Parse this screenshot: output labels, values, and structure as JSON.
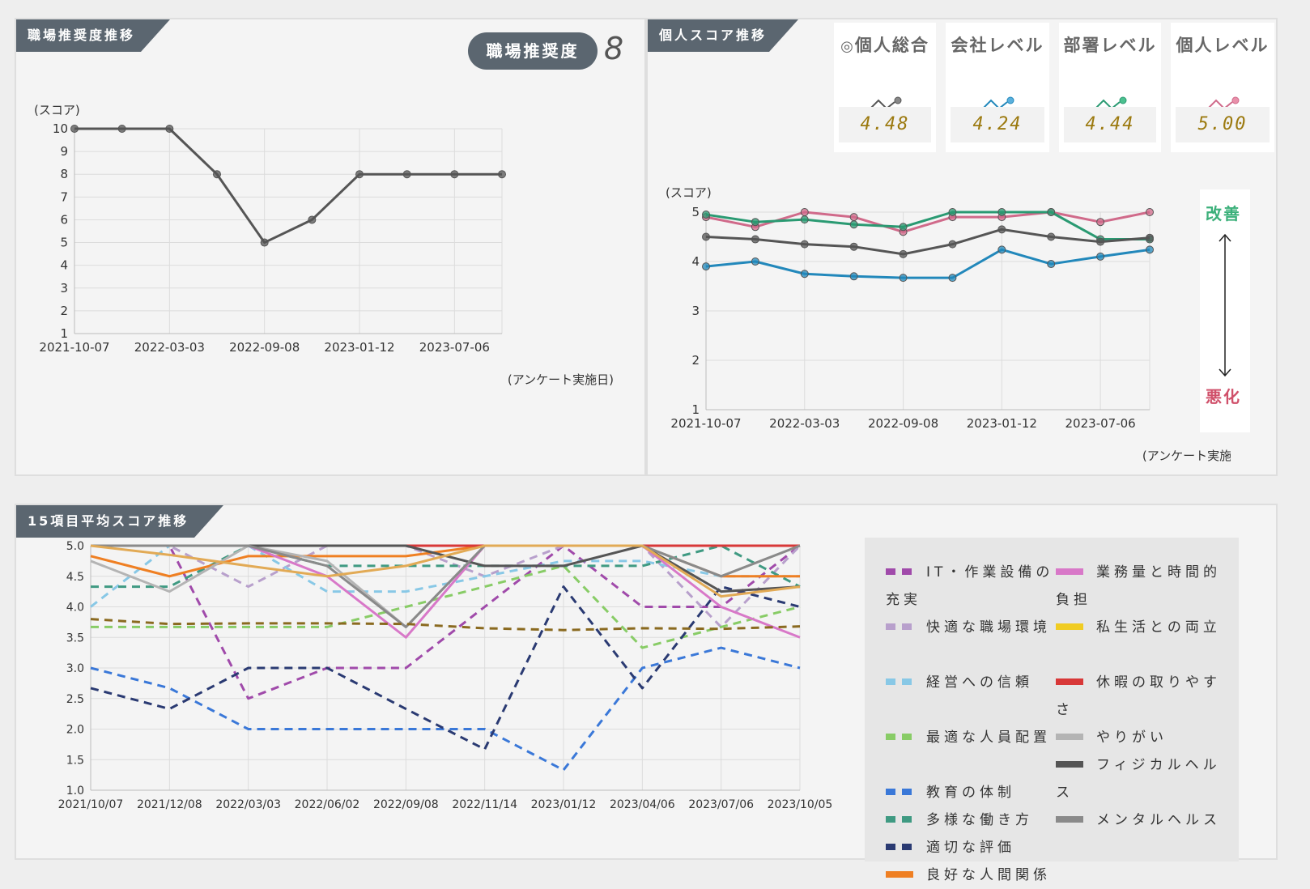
{
  "panels": {
    "workplace": {
      "title": "職場推奨度推移",
      "badge_label": "職場推奨度",
      "badge_value": "8"
    },
    "personal": {
      "title": "個人スコア推移"
    },
    "items15": {
      "title": "15項目平均スコア推移"
    }
  },
  "score_cards": [
    {
      "label": "個人総合",
      "value": "4.48",
      "color": "#555555",
      "icon": "target-icon"
    },
    {
      "label": "会社レベル",
      "value": "4.24",
      "color": "#2288bb"
    },
    {
      "label": "部署レベル",
      "value": "4.44",
      "color": "#2a9a72"
    },
    {
      "label": "個人レベル",
      "value": "5.00",
      "color": "#d06a8a"
    }
  ],
  "direction": {
    "up_label": "改善",
    "down_label": "悪化",
    "up_color": "#3bb07a",
    "down_color": "#d0506a"
  },
  "chart_data": [
    {
      "type": "line",
      "ylabel": "(スコア)",
      "xlabel": "(アンケート実施日)",
      "x": [
        "2021-10-07",
        "2021-12-08",
        "2022-03-03",
        "2022-06-02",
        "2022-09-08",
        "2022-11-14",
        "2023-01-12",
        "2023-04-06",
        "2023-07-06",
        "2023-10-05"
      ],
      "x_tick_labels": [
        "2021-10-07",
        "2022-03-03",
        "2022-09-08",
        "2023-01-12",
        "2023-07-06"
      ],
      "ylim": [
        1,
        10
      ],
      "y_ticks": [
        1,
        2,
        3,
        4,
        5,
        6,
        7,
        8,
        9,
        10
      ],
      "grid": true,
      "series": [
        {
          "values": [
            10,
            10,
            10,
            8,
            5,
            6,
            8,
            8,
            8,
            8
          ],
          "color": "#555555"
        }
      ]
    },
    {
      "type": "line",
      "ylabel": "(スコア)",
      "xlabel": "(アンケート実施日)",
      "x": [
        "2021-10-07",
        "2021-12-08",
        "2022-03-03",
        "2022-06-02",
        "2022-09-08",
        "2022-11-14",
        "2023-01-12",
        "2023-04-06",
        "2023-07-06",
        "2023-10-05"
      ],
      "x_tick_labels": [
        "2021-10-07",
        "2022-03-03",
        "2022-09-08",
        "2023-01-12",
        "2023-07-06"
      ],
      "ylim": [
        1,
        5
      ],
      "y_ticks": [
        1,
        2,
        3,
        4,
        5
      ],
      "grid": true,
      "series": [
        {
          "values": [
            4.9,
            4.7,
            5.0,
            4.9,
            4.6,
            4.9,
            4.9,
            5.0,
            4.8,
            5.0
          ],
          "color": "#d06a8a"
        },
        {
          "values": [
            4.95,
            4.8,
            4.85,
            4.75,
            4.7,
            5.0,
            5.0,
            5.0,
            4.45,
            4.45
          ],
          "color": "#2a9a72"
        },
        {
          "values": [
            4.5,
            4.45,
            4.35,
            4.3,
            4.15,
            4.35,
            4.65,
            4.5,
            4.4,
            4.48
          ],
          "color": "#555555"
        },
        {
          "values": [
            3.9,
            4.0,
            3.75,
            3.7,
            3.67,
            3.67,
            4.24,
            3.95,
            4.1,
            4.24
          ],
          "color": "#2288bb"
        }
      ]
    },
    {
      "type": "line",
      "x": [
        "2021/10/07",
        "2021/12/08",
        "2022/03/03",
        "2022/06/02",
        "2022/09/08",
        "2022/11/14",
        "2023/01/12",
        "2023/04/06",
        "2023/07/06",
        "2023/10/05"
      ],
      "ylim": [
        1.0,
        5.0
      ],
      "y_ticks": [
        "1.0",
        "1.5",
        "2.0",
        "2.5",
        "3.0",
        "3.5",
        "4.0",
        "4.5",
        "5.0"
      ],
      "grid": true,
      "legend_position": "right",
      "series": [
        {
          "name": "IT・作業設備の充実",
          "color": "#a04aaa",
          "dashed": true,
          "values": [
            5.0,
            5.0,
            2.5,
            3.0,
            3.0,
            4.0,
            5.0,
            4.0,
            4.0,
            5.0
          ]
        },
        {
          "name": "快適な職場環境",
          "color": "#b8a0cc",
          "dashed": true,
          "values": [
            5.0,
            5.0,
            4.33,
            5.0,
            5.0,
            4.5,
            5.0,
            5.0,
            3.67,
            5.0
          ]
        },
        {
          "name": "経営への信頼",
          "color": "#88c8e6",
          "dashed": true,
          "values": [
            4.0,
            5.0,
            5.0,
            4.25,
            4.25,
            4.5,
            4.75,
            4.75,
            4.5,
            4.5
          ]
        },
        {
          "name": "最適な人員配置",
          "color": "#88cc66",
          "dashed": true,
          "values": [
            3.67,
            3.67,
            3.67,
            3.67,
            4.0,
            4.33,
            4.67,
            3.33,
            3.67,
            4.0
          ]
        },
        {
          "name": "教育の体制",
          "color": "#3a78d8",
          "dashed": true,
          "values": [
            3.0,
            2.67,
            2.0,
            2.0,
            2.0,
            2.0,
            1.33,
            3.0,
            3.33,
            3.0
          ]
        },
        {
          "name": "多様な働き方",
          "color": "#3f9a82",
          "dashed": true,
          "values": [
            4.33,
            4.33,
            5.0,
            4.67,
            4.67,
            4.67,
            4.67,
            4.67,
            5.0,
            4.33
          ]
        },
        {
          "name": "適切な評価",
          "color": "#2a3a72",
          "dashed": true,
          "values": [
            2.67,
            2.33,
            3.0,
            3.0,
            2.33,
            1.67,
            4.33,
            2.67,
            4.33,
            4.0
          ]
        },
        {
          "name": "良好な人間関係",
          "color": "#ef7f22",
          "dashed": false,
          "values": [
            4.83,
            4.5,
            4.83,
            4.83,
            4.83,
            5.0,
            5.0,
            5.0,
            4.5,
            4.5
          ]
        },
        {
          "name": "業務量と時間的負担",
          "color": "#d878c8",
          "dashed": false,
          "values": [
            5.0,
            5.0,
            5.0,
            4.5,
            3.5,
            5.0,
            5.0,
            5.0,
            4.0,
            3.5
          ]
        },
        {
          "name": "私生活との両立",
          "color": "#f0cc22",
          "dashed": false,
          "values": [
            5.0,
            5.0,
            5.0,
            5.0,
            5.0,
            5.0,
            5.0,
            5.0,
            5.0,
            5.0
          ]
        },
        {
          "name": "休暇の取りやすさ",
          "color": "#d83838",
          "dashed": false,
          "values": [
            5.0,
            5.0,
            5.0,
            5.0,
            5.0,
            5.0,
            5.0,
            5.0,
            5.0,
            5.0
          ]
        },
        {
          "name": "やりがい",
          "color": "#b4b4b4",
          "dashed": false,
          "values": [
            4.75,
            4.25,
            5.0,
            4.75,
            3.67,
            5.0,
            5.0,
            5.0,
            4.5,
            5.0
          ]
        },
        {
          "name": "フィジカルヘルス",
          "color": "#555555",
          "dashed": false,
          "values": [
            5.0,
            5.0,
            5.0,
            5.0,
            5.0,
            4.67,
            4.67,
            5.0,
            4.25,
            4.33
          ]
        },
        {
          "name": "メンタルヘルス",
          "color": "#8a8a8a",
          "dashed": false,
          "values": [
            5.0,
            5.0,
            5.0,
            4.67,
            3.67,
            5.0,
            5.0,
            5.0,
            4.5,
            5.0
          ]
        },
        {
          "name": "",
          "color": "#8a6a20",
          "dashed": true,
          "values": [
            3.8,
            3.72,
            3.73,
            3.73,
            3.72,
            3.65,
            3.62,
            3.65,
            3.64,
            3.68
          ]
        },
        {
          "name": "",
          "color": "#e2aa55",
          "dashed": false,
          "values": [
            5.0,
            4.85,
            4.67,
            4.5,
            4.67,
            5.0,
            5.0,
            5.0,
            4.17,
            4.33
          ]
        }
      ]
    }
  ]
}
